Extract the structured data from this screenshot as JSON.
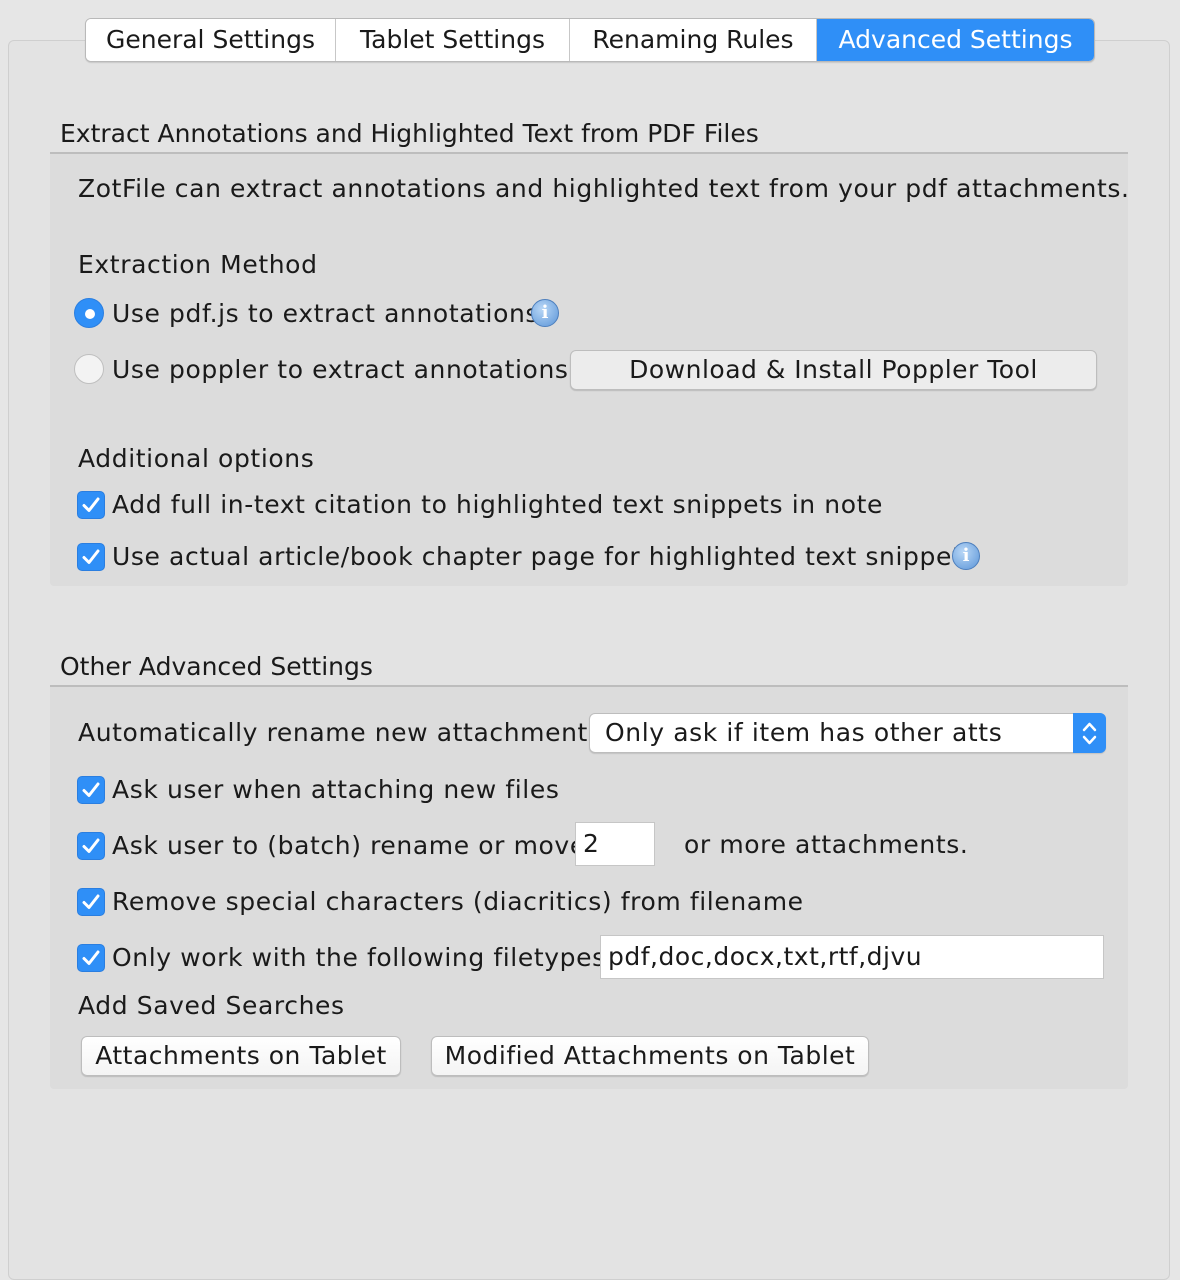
{
  "tabs": [
    {
      "label": "General Settings",
      "active": false
    },
    {
      "label": "Tablet Settings",
      "active": false
    },
    {
      "label": "Renaming Rules",
      "active": false
    },
    {
      "label": "Advanced Settings",
      "active": true
    }
  ],
  "extraction": {
    "title": "Extract Annotations and Highlighted Text from PDF Files",
    "description": "ZotFile can extract annotations and highlighted text from your pdf attachments.",
    "method_label": "Extraction Method",
    "option_pdfjs": "Use pdf.js to extract annotations",
    "option_poppler": "Use poppler to extract annotations",
    "download_button": "Download & Install Poppler Tool",
    "additional_label": "Additional options",
    "opt_citation": "Add full in-text citation to highlighted text snippets in note",
    "opt_page": "Use actual article/book chapter page for highlighted text snippets"
  },
  "other": {
    "title": "Other Advanced Settings",
    "rename_label": "Automatically rename new attachments",
    "rename_value": "Only ask if item has other atts",
    "ask_attach": "Ask user when attaching new files",
    "ask_batch": "Ask user to (batch) rename or move",
    "batch_count": "2",
    "batch_suffix": "or more attachments.",
    "remove_special": "Remove special characters (diacritics) from filename",
    "filetypes_label": "Only work with the following filetypes",
    "filetypes_value": "pdf,doc,docx,txt,rtf,djvu",
    "saved_searches_label": "Add Saved Searches",
    "btn_attachments": "Attachments on Tablet",
    "btn_modified": "Modified Attachments on Tablet"
  },
  "icons": {
    "info": "info-icon",
    "checkmark": "checkmark-icon",
    "select_arrows": "up-down-arrows-icon"
  },
  "colors": {
    "accent": "#2f8ff7",
    "background": "#e6e6e6"
  }
}
